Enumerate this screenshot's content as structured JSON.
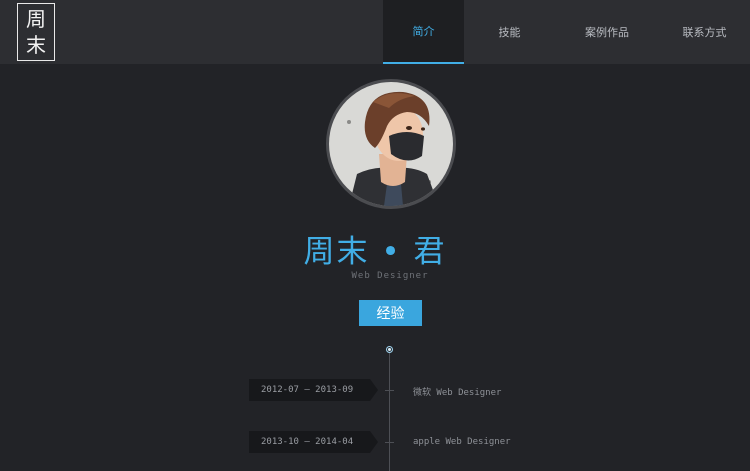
{
  "logo": {
    "line1": "周",
    "line2": "末"
  },
  "nav": [
    {
      "label": "简介",
      "active": true
    },
    {
      "label": "技能",
      "active": false
    },
    {
      "label": "案例作品",
      "active": false
    },
    {
      "label": "联系方式",
      "active": false
    }
  ],
  "profile": {
    "name": "周末 • 君",
    "role": "Web Designer",
    "experience_button": "经验"
  },
  "timeline": [
    {
      "dates": "2012-07 — 2013-09",
      "job": "微软 Web Designer"
    },
    {
      "dates": "2013-10 — 2014-04",
      "job": "apple Web Designer"
    }
  ],
  "colors": {
    "accent": "#41aee6",
    "background": "#222327",
    "header": "#2d2e32"
  }
}
